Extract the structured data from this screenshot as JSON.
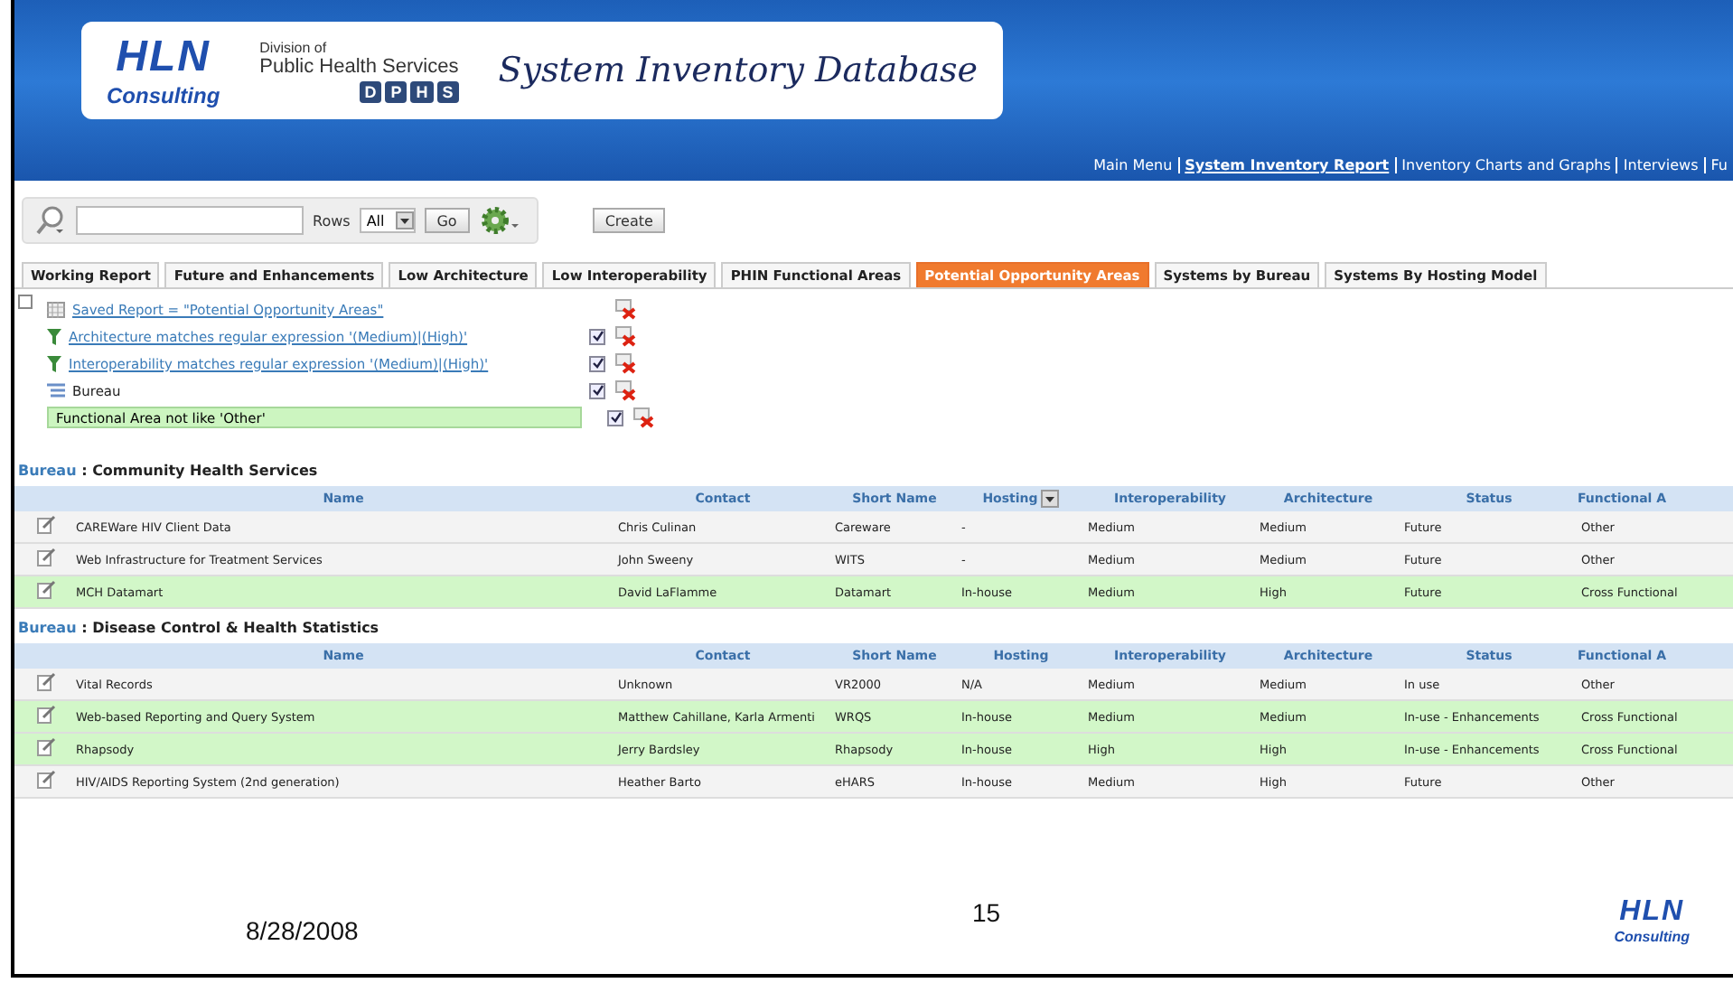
{
  "header": {
    "logo": {
      "big": "HLN",
      "small": "Consulting"
    },
    "division": {
      "line1": "Division of",
      "line2": "Public Health Services",
      "letters": [
        "D",
        "P",
        "H",
        "S"
      ]
    },
    "title": "System Inventory Database"
  },
  "nav": [
    {
      "label": "Main Menu",
      "selected": false
    },
    {
      "label": "System Inventory Report",
      "selected": true
    },
    {
      "label": "Inventory Charts and Graphs",
      "selected": false
    },
    {
      "label": "Interviews",
      "selected": false
    },
    {
      "label": "Fu",
      "selected": false
    }
  ],
  "toolbar": {
    "rows_label": "Rows",
    "rows_value": "All",
    "go": "Go",
    "create": "Create"
  },
  "tabs": [
    {
      "label": "Working Report",
      "selected": false
    },
    {
      "label": "Future and Enhancements",
      "selected": false
    },
    {
      "label": "Low Architecture",
      "selected": false
    },
    {
      "label": "Low Interoperability",
      "selected": false
    },
    {
      "label": "PHIN Functional Areas",
      "selected": false
    },
    {
      "label": "Potential Opportunity Areas",
      "selected": true
    },
    {
      "label": "Systems by Bureau",
      "selected": false
    },
    {
      "label": "Systems By Hosting Model",
      "selected": false
    }
  ],
  "filters": [
    {
      "kind": "report",
      "text": "Saved Report = \"Potential Opportunity Areas\"",
      "link": true
    },
    {
      "kind": "filter",
      "text": "Architecture matches regular expression '(Medium)|(High)'",
      "link": true,
      "checked": true
    },
    {
      "kind": "filter",
      "text": "Interoperability matches regular expression '(Medium)|(High)'",
      "link": true,
      "checked": true
    },
    {
      "kind": "group",
      "text": "Bureau",
      "link": false,
      "checked": true
    },
    {
      "kind": "highlight",
      "text": "Functional Area not like 'Other'",
      "checked": true
    }
  ],
  "groups": [
    {
      "label": "Bureau",
      "separator": ":",
      "value": "Community Health Services",
      "columns": [
        {
          "label": "Name",
          "menu": false
        },
        {
          "label": "Contact",
          "menu": false
        },
        {
          "label": "Short Name",
          "menu": false
        },
        {
          "label": "Hosting",
          "menu": true
        },
        {
          "label": "Interoperability",
          "menu": false
        },
        {
          "label": "Architecture",
          "menu": false
        },
        {
          "label": "Status",
          "menu": false
        },
        {
          "label": "Functional A",
          "menu": false
        }
      ],
      "rows": [
        {
          "highlighted": false,
          "cells": [
            "CAREWare HIV Client Data",
            "Chris Culinan",
            "Careware",
            "-",
            "Medium",
            "Medium",
            "Future",
            "Other"
          ]
        },
        {
          "highlighted": false,
          "cells": [
            "Web Infrastructure for Treatment Services",
            "John Sweeny",
            "WITS",
            "-",
            "Medium",
            "Medium",
            "Future",
            "Other"
          ]
        },
        {
          "highlighted": true,
          "cells": [
            "MCH Datamart",
            "David LaFlamme",
            "Datamart",
            "In-house",
            "Medium",
            "High",
            "Future",
            "Cross Functional"
          ]
        }
      ]
    },
    {
      "label": "Bureau",
      "separator": ":",
      "value": "Disease Control & Health Statistics",
      "columns": [
        {
          "label": "Name",
          "menu": false
        },
        {
          "label": "Contact",
          "menu": false
        },
        {
          "label": "Short Name",
          "menu": false
        },
        {
          "label": "Hosting",
          "menu": false
        },
        {
          "label": "Interoperability",
          "menu": false
        },
        {
          "label": "Architecture",
          "menu": false
        },
        {
          "label": "Status",
          "menu": false
        },
        {
          "label": "Functional A",
          "menu": false
        }
      ],
      "rows": [
        {
          "highlighted": false,
          "cells": [
            "Vital Records",
            "Unknown",
            "VR2000",
            "N/A",
            "Medium",
            "Medium",
            "In use",
            "Other"
          ]
        },
        {
          "highlighted": true,
          "cells": [
            "Web-based Reporting and Query System",
            "Matthew Cahillane, Karla Armenti",
            "WRQS",
            "In-house",
            "Medium",
            "Medium",
            "In-use - Enhancements",
            "Cross Functional"
          ]
        },
        {
          "highlighted": true,
          "cells": [
            "Rhapsody",
            "Jerry Bardsley",
            "Rhapsody",
            "In-house",
            "High",
            "High",
            "In-use - Enhancements",
            "Cross Functional"
          ]
        },
        {
          "highlighted": false,
          "cells": [
            "HIV/AIDS Reporting System (2nd generation)",
            "Heather Barto",
            "eHARS",
            "In-house",
            "Medium",
            "High",
            "Future",
            "Other"
          ]
        }
      ]
    }
  ],
  "footer": {
    "date": "8/28/2008",
    "page": "15",
    "logo": {
      "big": "HLN",
      "small": "Consulting"
    }
  }
}
